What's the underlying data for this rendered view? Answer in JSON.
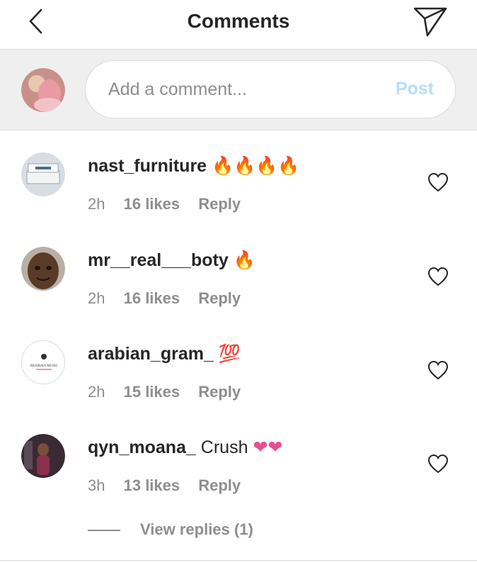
{
  "header": {
    "title": "Comments"
  },
  "compose": {
    "placeholder": "Add a comment...",
    "post_label": "Post"
  },
  "comments": [
    {
      "username": "nast_furniture",
      "text": "",
      "emoji": "🔥🔥🔥🔥",
      "time": "2h",
      "likes": "16 likes",
      "reply": "Reply"
    },
    {
      "username": "mr__real___boty",
      "text": "",
      "emoji": "🔥",
      "time": "2h",
      "likes": "16 likes",
      "reply": "Reply"
    },
    {
      "username": "arabian_gram_",
      "text": "",
      "emoji": "💯",
      "time": "2h",
      "likes": "15 likes",
      "reply": "Reply",
      "avatar_label": "ARABIAN MUSIC"
    },
    {
      "username": "qyn_moana_",
      "text": "Crush",
      "emoji": "❤❤",
      "time": "3h",
      "likes": "13 likes",
      "reply": "Reply"
    }
  ],
  "view_replies": "View replies (1)",
  "colors": {
    "accent_link": "#b2dffc",
    "text": "#262626",
    "muted": "#8e8e8e",
    "divider": "#dbdbdb"
  }
}
